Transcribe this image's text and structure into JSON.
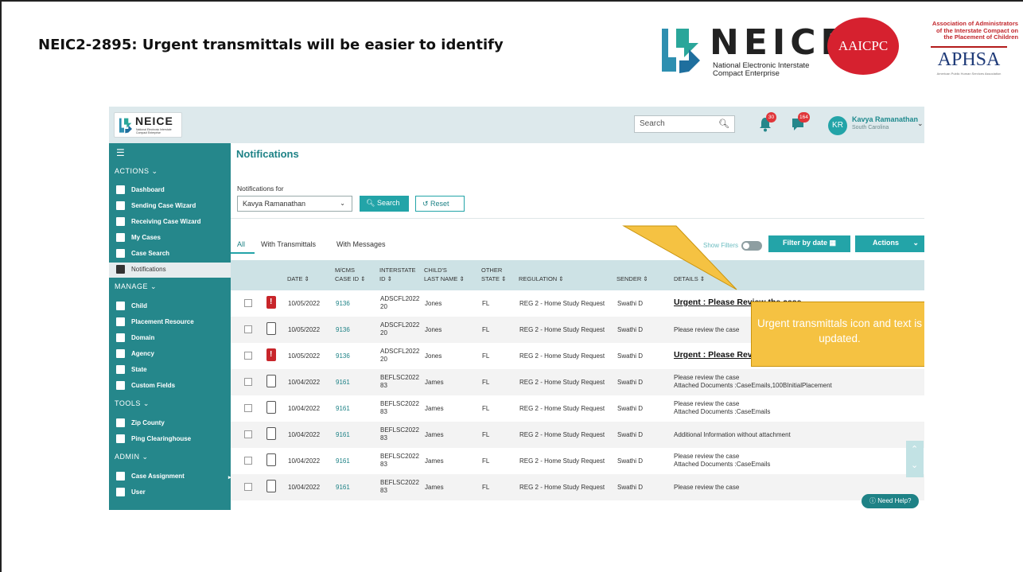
{
  "slide": {
    "title": "NEIC2-2895: Urgent transmittals will be easier to identify",
    "callout": "Urgent transmittals icon and text is updated."
  },
  "logos": {
    "neice_word": "NEICE",
    "neice_sub_line1": "National Electronic Interstate",
    "neice_sub_line2": "Compact Enterprise",
    "aaicpc": "AAICPC",
    "assoc_line1": "Association of Administrators",
    "assoc_line2": "of the Interstate Compact on",
    "assoc_line3": "the Placement of Children",
    "aphsa": "APHSA",
    "aphsa_sub": "American Public Human Services Association"
  },
  "app": {
    "logo_word": "NEICE",
    "logo_sub": "National Electronic Interstate Compact Enterprise",
    "search_placeholder": "Search",
    "bell_count": "30",
    "chat_count": "164",
    "avatar_initials": "KR",
    "user_name": "Kavya Ramanathan",
    "user_state": "South Carolina"
  },
  "sidebar": {
    "actions_head": "ACTIONS",
    "actions": [
      "Dashboard",
      "Sending Case Wizard",
      "Receiving Case Wizard",
      "My Cases",
      "Case Search",
      "Notifications"
    ],
    "manage_head": "MANAGE",
    "manage": [
      "Child",
      "Placement Resource",
      "Domain",
      "Agency",
      "State",
      "Custom Fields"
    ],
    "tools_head": "TOOLS",
    "tools": [
      "Zip County",
      "Ping Clearinghouse"
    ],
    "admin_head": "ADMIN",
    "admin": [
      "Case Assignment",
      "User"
    ]
  },
  "content": {
    "page_title": "Notifications",
    "notifications_for_label": "Notifications for",
    "notifications_for_value": "Kavya Ramanathan",
    "search_btn": "Search",
    "reset_btn": "Reset",
    "tabs": [
      "All",
      "With Transmittals",
      "With Messages"
    ],
    "show_filters": "Show Filters",
    "filter_by_date": "Filter by date",
    "actions_btn": "Actions",
    "need_help": "Need Help?"
  },
  "table": {
    "headers": {
      "date": "DATE",
      "mcms_1": "M/CMS",
      "mcms_2": "CASE ID",
      "interstate_1": "INTERSTATE",
      "interstate_2": "ID",
      "child_1": "CHILD'S",
      "child_2": "LAST NAME",
      "other_1": "OTHER",
      "other_2": "STATE",
      "regulation": "REGULATION",
      "sender": "SENDER",
      "details": "DETAILS"
    },
    "rows": [
      {
        "icon": "urgent",
        "date": "10/05/2022",
        "case_id": "9136",
        "interstate_1": "ADSCFL2022",
        "interstate_2": "20",
        "child": "Jones",
        "state": "FL",
        "regulation": "REG 2 - Home Study Request",
        "sender": "Swathi D",
        "details_1": "Urgent : Please Review the case",
        "details_2": "",
        "urgent": true
      },
      {
        "icon": "doc",
        "date": "10/05/2022",
        "case_id": "9136",
        "interstate_1": "ADSCFL2022",
        "interstate_2": "20",
        "child": "Jones",
        "state": "FL",
        "regulation": "REG 2 - Home Study Request",
        "sender": "Swathi D",
        "details_1": "Please review the case",
        "details_2": "",
        "urgent": false
      },
      {
        "icon": "urgent",
        "date": "10/05/2022",
        "case_id": "9136",
        "interstate_1": "ADSCFL2022",
        "interstate_2": "20",
        "child": "Jones",
        "state": "FL",
        "regulation": "REG 2 - Home Study Request",
        "sender": "Swathi D",
        "details_1": "Urgent : Please Review the case",
        "details_2": "",
        "urgent": true
      },
      {
        "icon": "attach",
        "date": "10/04/2022",
        "case_id": "9161",
        "interstate_1": "BEFLSC2022",
        "interstate_2": "83",
        "child": "James",
        "state": "FL",
        "regulation": "REG 2 - Home Study Request",
        "sender": "Swathi D",
        "details_1": "Please review the case",
        "details_2": "Attached Documents :CaseEmails,100BInitialPlacement",
        "urgent": false
      },
      {
        "icon": "attach",
        "date": "10/04/2022",
        "case_id": "9161",
        "interstate_1": "BEFLSC2022",
        "interstate_2": "83",
        "child": "James",
        "state": "FL",
        "regulation": "REG 2 - Home Study Request",
        "sender": "Swathi D",
        "details_1": "Please review the case",
        "details_2": "Attached Documents :CaseEmails",
        "urgent": false
      },
      {
        "icon": "doc",
        "date": "10/04/2022",
        "case_id": "9161",
        "interstate_1": "BEFLSC2022",
        "interstate_2": "83",
        "child": "James",
        "state": "FL",
        "regulation": "REG 2 - Home Study Request",
        "sender": "Swathi D",
        "details_1": "Additional Information without attachment",
        "details_2": "",
        "urgent": false
      },
      {
        "icon": "attach",
        "date": "10/04/2022",
        "case_id": "9161",
        "interstate_1": "BEFLSC2022",
        "interstate_2": "83",
        "child": "James",
        "state": "FL",
        "regulation": "REG 2 - Home Study Request",
        "sender": "Swathi D",
        "details_1": "Please review the case",
        "details_2": "Attached Documents :CaseEmails",
        "urgent": false
      },
      {
        "icon": "doc",
        "date": "10/04/2022",
        "case_id": "9161",
        "interstate_1": "BEFLSC2022",
        "interstate_2": "83",
        "child": "James",
        "state": "FL",
        "regulation": "REG 2 - Home Study Request",
        "sender": "Swathi D",
        "details_1": "Please review the case",
        "details_2": "",
        "urgent": false
      }
    ]
  },
  "colors": {
    "teal": "#23a4a8",
    "sidebar": "#25878b",
    "callout": "#f5c242",
    "urgent": "#c8252a"
  }
}
